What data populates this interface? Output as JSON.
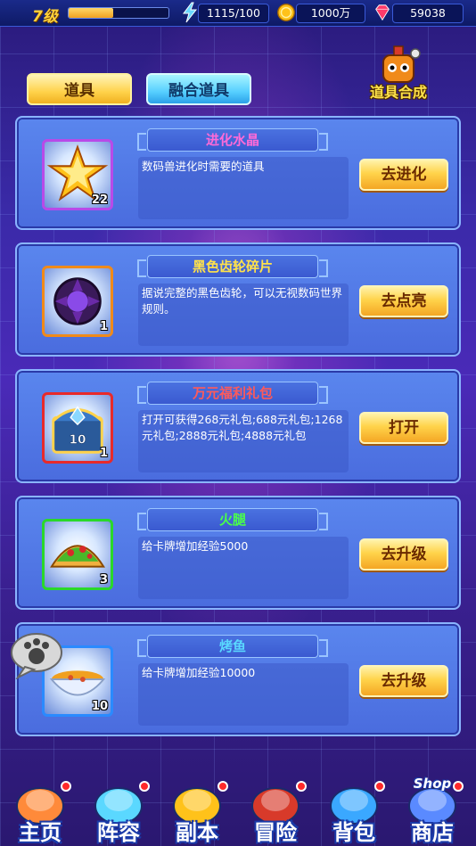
{
  "status": {
    "level": "7级",
    "xp_fraction": 0.45,
    "energy": "1115/100",
    "coins": "1000万",
    "gems": "59038"
  },
  "tabs": [
    {
      "label": "道具",
      "active": true
    },
    {
      "label": "融合道具",
      "active": false
    }
  ],
  "synthesis_label": "道具合成",
  "items": [
    {
      "name": "进化水晶",
      "name_color": "#ff6ad8",
      "frame_color": "#b84ae8",
      "description": "数码兽进化时需要的道具",
      "count": "22",
      "button": "去进化",
      "icon": "evolution-crystal-icon"
    },
    {
      "name": "黑色齿轮碎片",
      "name_color": "#ffe24a",
      "frame_color": "#f08a1a",
      "description": "据说完整的黑色齿轮，可以无视数码世界规则。",
      "count": "1",
      "button": "去点亮",
      "icon": "black-gear-icon"
    },
    {
      "name": "万元福利礼包",
      "name_color": "#ff5a5a",
      "frame_color": "#e82a2a",
      "description": "打开可获得268元礼包;688元礼包;1268元礼包;2888元礼包;4888元礼包",
      "count": "1",
      "button": "打开",
      "icon": "gift-chest-icon",
      "chest_number": "10"
    },
    {
      "name": "火腿",
      "name_color": "#4aff4a",
      "frame_color": "#2ad82a",
      "description": "给卡牌增加经验5000",
      "count": "3",
      "button": "去升级",
      "icon": "taco-icon"
    },
    {
      "name": "烤鱼",
      "name_color": "#5ad8ff",
      "frame_color": "#2a8aff",
      "description": "给卡牌增加经验10000",
      "count": "10",
      "button": "去升级",
      "icon": "soup-bowl-icon"
    }
  ],
  "nav": [
    {
      "label": "主页",
      "icon": "home-dome-icon"
    },
    {
      "label": "阵容",
      "icon": "lineup-icon"
    },
    {
      "label": "副本",
      "icon": "dungeon-crystal-icon"
    },
    {
      "label": "冒险",
      "icon": "adventure-icon"
    },
    {
      "label": "背包",
      "icon": "backpack-icon"
    },
    {
      "label": "商店",
      "icon": "shop-icon",
      "badge": "Shop"
    }
  ]
}
